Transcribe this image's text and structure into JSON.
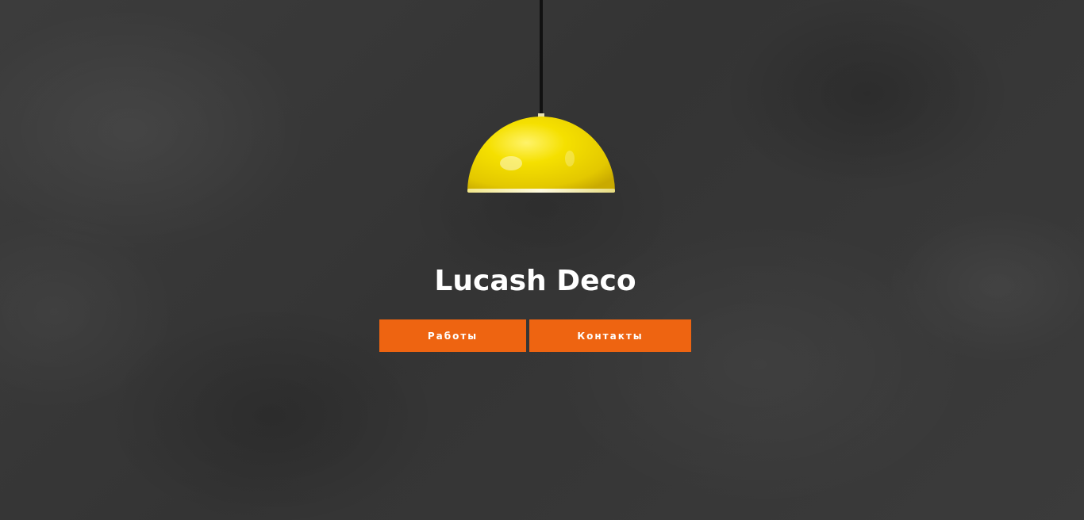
{
  "hero": {
    "title": "Lucash Deco",
    "buttons": {
      "works_label": "Работы",
      "contacts_label": "Контакты"
    }
  },
  "colors": {
    "background": "#3a3a3a",
    "accent": "#ee6411",
    "lamp": "#f2d400",
    "title_text": "#ffffff"
  },
  "icons": {
    "lamp": "pendant-lamp-icon"
  }
}
